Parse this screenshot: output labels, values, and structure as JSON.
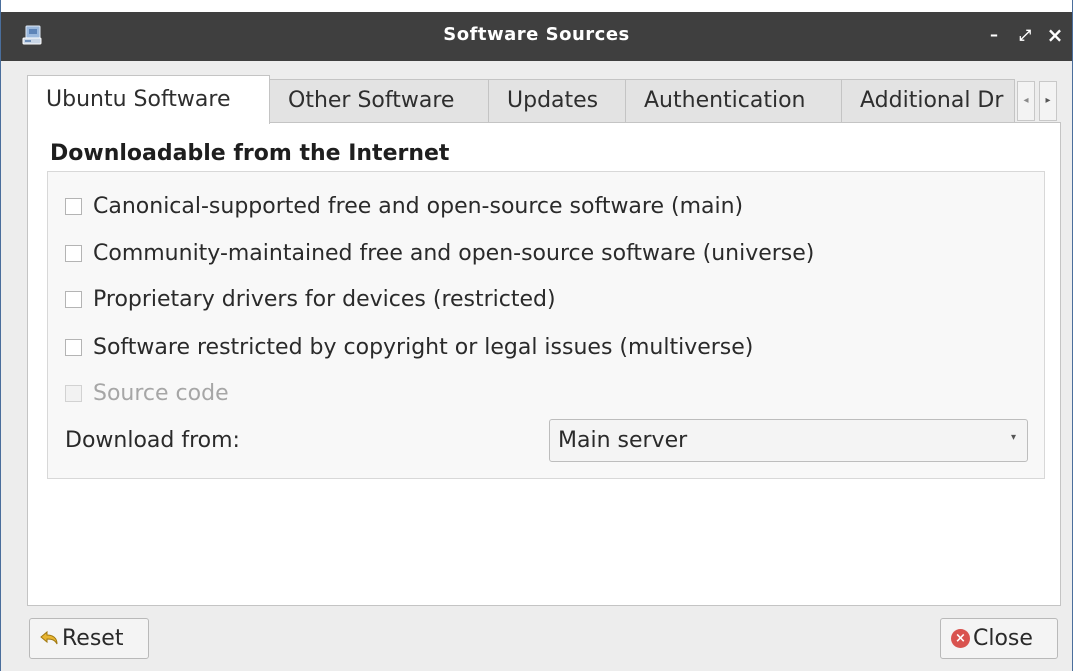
{
  "window": {
    "title": "Software Sources",
    "controls": {
      "minimize": "–",
      "maximize": "⤢",
      "close": "×"
    }
  },
  "tabs": [
    {
      "label": "Ubuntu Software",
      "active": true
    },
    {
      "label": "Other Software",
      "active": false
    },
    {
      "label": "Updates",
      "active": false
    },
    {
      "label": "Authentication",
      "active": false
    },
    {
      "label": "Additional Dr",
      "active": false
    }
  ],
  "tab_scroll": {
    "left": "◂",
    "right": "▸"
  },
  "section": {
    "heading": "Downloadable from the Internet"
  },
  "options": [
    {
      "label": "Canonical-supported free and open-source software (main)",
      "checked": false,
      "enabled": true
    },
    {
      "label": "Community-maintained free and open-source software (universe)",
      "checked": false,
      "enabled": true
    },
    {
      "label": "Proprietary drivers for devices (restricted)",
      "checked": false,
      "enabled": true
    },
    {
      "label": "Software restricted by copyright or legal issues (multiverse)",
      "checked": false,
      "enabled": true
    },
    {
      "label": "Source code",
      "checked": false,
      "enabled": false
    }
  ],
  "download": {
    "label": "Download from:",
    "selected": "Main server",
    "arrow": "▾"
  },
  "buttons": {
    "reset": "Reset",
    "close": "Close",
    "close_icon": "×"
  },
  "colors": {
    "titlebar": "#3f3f3f",
    "window_border": "#4a6e9c",
    "close_icon": "#d9534f",
    "reset_icon": "#e8b531"
  }
}
